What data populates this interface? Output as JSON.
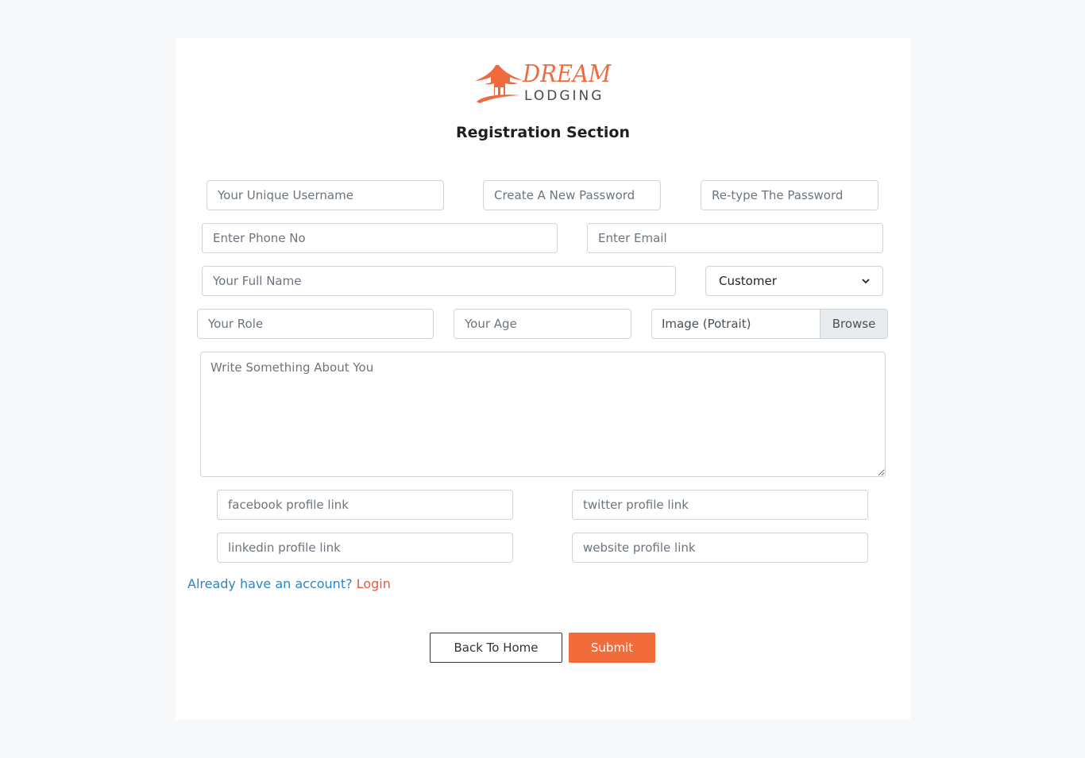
{
  "brand": {
    "word1": "DREAM",
    "word2": "LODGING",
    "accent_color": "#f26b3a"
  },
  "title": "Registration Section",
  "form": {
    "username_placeholder": "Your Unique Username",
    "password_placeholder": "Create A New Password",
    "retype_placeholder": "Re-type The Password",
    "phone_placeholder": "Enter Phone No",
    "email_placeholder": "Enter Email",
    "fullname_placeholder": "Your Full Name",
    "account_type_selected": "Customer",
    "role_placeholder": "Your Role",
    "age_placeholder": "Your Age",
    "image_label": "Image (Potrait)",
    "browse_label": "Browse",
    "about_placeholder": "Write Something About You",
    "facebook_placeholder": "facebook profile link",
    "twitter_placeholder": "twitter profile link",
    "linkedin_placeholder": "linkedin profile link",
    "website_placeholder": "website profile link"
  },
  "account": {
    "question": "Already have an account?",
    "login_label": "Login"
  },
  "buttons": {
    "home_label": "Back To Home",
    "submit_label": "Submit"
  }
}
